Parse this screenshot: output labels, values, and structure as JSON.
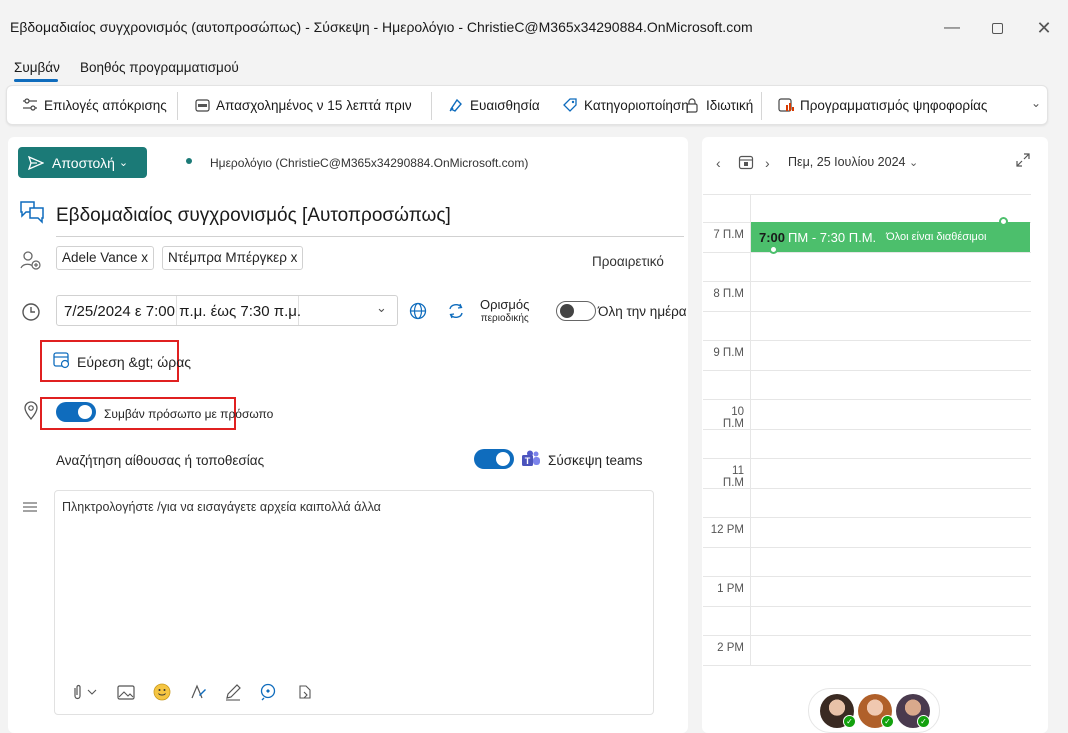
{
  "window": {
    "title": "Εβδομαδιαίος συγχρονισμός (αυτοπροσώπως) - Σύσκεψη - Ημερολόγιο - ChristieC@M365x34290884.OnMicrosoft.com",
    "minimize_icon": "minimize-icon",
    "maximize_icon": "maximize-icon",
    "close_icon": "close-icon"
  },
  "tabs": [
    {
      "label": "Συμβάν"
    },
    {
      "label": "Βοηθός προγραμματισμού"
    }
  ],
  "ribbon": {
    "response_options": "Επιλογές απόκρισης",
    "busy_reminder": "Απασχολημένος ν 15 λεπτά πριν",
    "sensitivity": "Ευαισθησία",
    "categorize": "Κατηγοριοποίηση",
    "private": "Ιδιωτική",
    "scheduling_poll": "Προγραμματισμός ψηφοφορίας"
  },
  "compose": {
    "send_label": "Αποστολή",
    "calendar_label": "Ημερολόγιο (ChristieC@M365x34290884.OnMicrosoft.com)",
    "subject": "Εβδομαδιαίος συγχρονισμός [Αυτοπροσώπως]",
    "attendees": [
      "Adele Vance x",
      "Ντέμπρα Μπέργκερ x"
    ],
    "optional_label": "Προαιρετικό",
    "datetime": "7/25/2024 ε 7:00 π.μ. έως 7:30 π.μ.",
    "recurrence_label": "Ορισμός",
    "recurrence_sub": "περιοδικής",
    "all_day_label": "Όλη την ημέρα",
    "all_day_on": false,
    "find_time_label": "Εύρεση &gt; ώρας",
    "in_person_label": "Συμβάν πρόσωπο με πρόσωπο",
    "in_person_on": true,
    "location_placeholder": "Αναζήτηση αίθουσας ή τοποθεσίας",
    "teams_label": "Σύσκεψη teams",
    "teams_on": true,
    "body_placeholder": "Πληκτρολογήστε /για να εισαγάγετε αρχεία καιπολλά άλλα"
  },
  "calendar_pane": {
    "date_label": "Πεμ, 25 Ιουλίου 2024",
    "hours": [
      "7 Π.Μ",
      "8 Π.Μ",
      "9 Π.Μ",
      "10 Π.Μ",
      "11 Π.Μ",
      "12 PM",
      "1 PM",
      "2 PM"
    ],
    "event_time": "7:00",
    "event_range": "ΠΜ - 7:30 Π.Μ.",
    "event_status": "Όλοι είναι διαθέσιμοι"
  },
  "colors": {
    "accent": "#0f6cbd",
    "send": "#1b7a77",
    "event": "#4cbf6c",
    "highlight": "#e02020"
  }
}
